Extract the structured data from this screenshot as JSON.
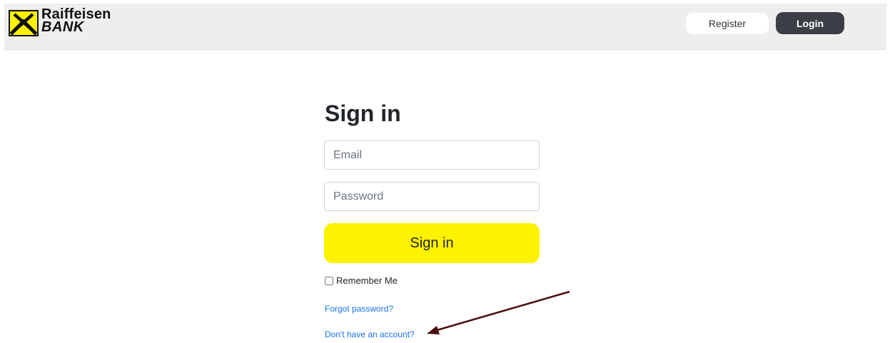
{
  "brand": {
    "name": "Raiffeisen",
    "sub": "BANK",
    "accent_color": "#fff200"
  },
  "header": {
    "register_label": "Register",
    "login_label": "Login"
  },
  "form": {
    "title": "Sign in",
    "email_placeholder": "Email",
    "email_value": "",
    "password_placeholder": "Password",
    "password_value": "",
    "submit_label": "Sign in",
    "remember_label": "Remember Me",
    "remember_checked": false,
    "forgot_link": "Forgot password?",
    "signup_link": "Don't have an account?"
  },
  "annotation": {
    "icon": "arrow-annotation-icon",
    "color": "#4a0f0f"
  },
  "colors": {
    "header_bg": "#eeeeee",
    "login_bg": "#3b3f45",
    "link": "#1a73e8"
  }
}
